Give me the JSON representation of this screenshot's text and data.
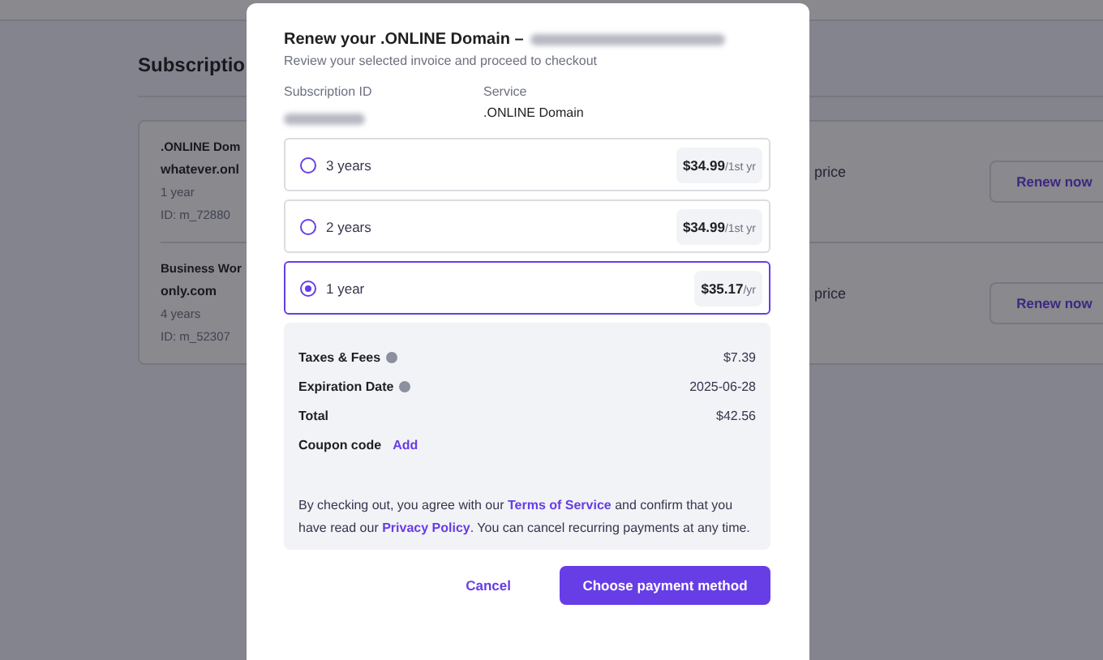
{
  "page": {
    "title": "Subscriptio",
    "subscriptions": [
      {
        "name": ".ONLINE Dom",
        "domain": "whatever.onl",
        "term": "1 year",
        "id": "ID: m_72880",
        "note": "price",
        "action": "Renew now"
      },
      {
        "name": "Business Wor",
        "domain": "only.com",
        "term": "4 years",
        "id": "ID: m_52307",
        "note": "price",
        "action": "Renew now"
      }
    ]
  },
  "modal": {
    "title": "Renew your .ONLINE Domain –",
    "subtitle": "Review your selected invoice and proceed to checkout",
    "fields": [
      {
        "label": "Subscription ID",
        "redacted": true
      },
      {
        "label": "Service",
        "value": ".ONLINE Domain"
      }
    ],
    "options": [
      {
        "label": "3 years",
        "price": "$34.99",
        "unit": "/1st yr",
        "selected": false
      },
      {
        "label": "2 years",
        "price": "$34.99",
        "unit": "/1st yr",
        "selected": false
      },
      {
        "label": "1 year",
        "price": "$35.17",
        "unit": "/yr",
        "selected": true
      }
    ],
    "summary": [
      {
        "label": "Taxes & Fees",
        "info": true,
        "value": "$7.39"
      },
      {
        "label": "Expiration Date",
        "info": true,
        "value": "2025-06-28"
      },
      {
        "label": "Total",
        "info": false,
        "value": "$42.56"
      }
    ],
    "coupon": {
      "label": "Coupon code",
      "action": "Add"
    },
    "terms": [
      {
        "kind": "text",
        "text": "By checking out, you agree with our "
      },
      {
        "kind": "link",
        "text": "Terms of Service"
      },
      {
        "kind": "text",
        "text": " and confirm that you have read our "
      },
      {
        "kind": "link",
        "text": "Privacy Policy"
      },
      {
        "kind": "text",
        "text": ". You can cancel recurring payments at any time."
      }
    ],
    "cancel": "Cancel",
    "submit": "Choose payment method"
  }
}
